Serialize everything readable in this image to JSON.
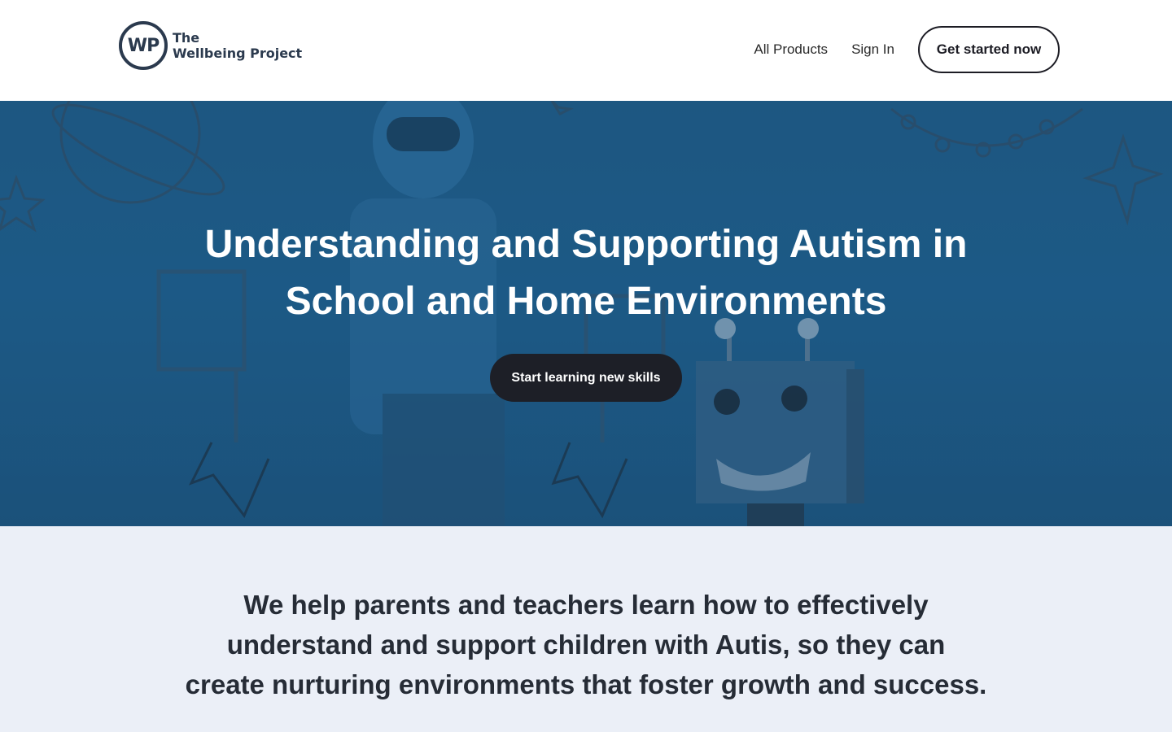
{
  "header": {
    "logo_mark": "WP",
    "logo_line1": "The",
    "logo_line2": "Wellbeing Project",
    "nav": {
      "all_products": "All Products",
      "sign_in": "Sign In",
      "cta": "Get started now"
    }
  },
  "hero": {
    "title_line1": "Understanding and Supporting Autism in",
    "title_line2": "School and Home Environments",
    "button": "Start learning new skills"
  },
  "mission": {
    "line1": "We help parents and teachers learn how to effectively",
    "line2": "understand and support children with Autis, so they can",
    "line3": "create nurturing environments that foster growth and success."
  },
  "colors": {
    "brand_dark": "#2b3a4e",
    "hero_blue": "#1c5a87",
    "button_dark": "#1d1f27",
    "mission_bg": "#ebeff7"
  }
}
